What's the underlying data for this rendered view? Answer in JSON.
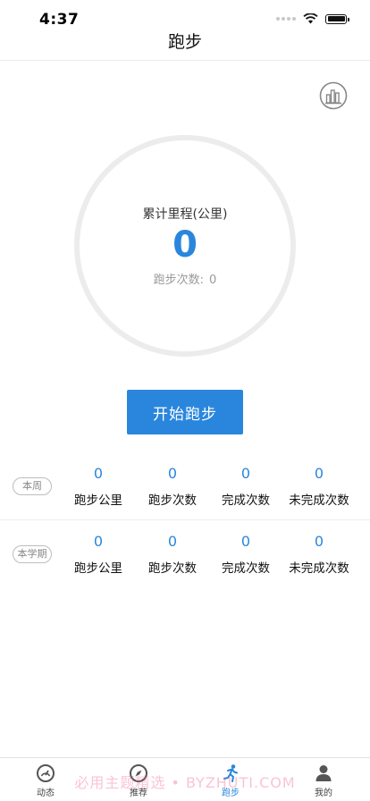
{
  "status_bar": {
    "time": "4:37"
  },
  "header": {
    "title": "跑步"
  },
  "stats_button": {
    "icon": "bar-chart-icon"
  },
  "summary": {
    "label": "累计里程(公里)",
    "distance": "0",
    "runs_label": "跑步次数:",
    "runs_value": "0"
  },
  "start_button": {
    "label": "开始跑步"
  },
  "stats": [
    {
      "badge": "本周",
      "items": [
        {
          "value": "0",
          "label": "跑步公里"
        },
        {
          "value": "0",
          "label": "跑步次数"
        },
        {
          "value": "0",
          "label": "完成次数"
        },
        {
          "value": "0",
          "label": "未完成次数"
        }
      ]
    },
    {
      "badge": "本学期",
      "items": [
        {
          "value": "0",
          "label": "跑步公里"
        },
        {
          "value": "0",
          "label": "跑步次数"
        },
        {
          "value": "0",
          "label": "完成次数"
        },
        {
          "value": "0",
          "label": "未完成次数"
        }
      ]
    }
  ],
  "tabs": [
    {
      "label": "动态",
      "icon": "speedometer-icon"
    },
    {
      "label": "推荐",
      "icon": "compass-icon"
    },
    {
      "label": "跑步",
      "icon": "runner-icon",
      "active": true
    },
    {
      "label": "我的",
      "icon": "person-icon"
    }
  ],
  "watermark": "必用主题精选 • BYZHUTI.COM",
  "colors": {
    "accent": "#2a86dc",
    "ring": "#ececec",
    "muted": "#9a9a9a"
  }
}
